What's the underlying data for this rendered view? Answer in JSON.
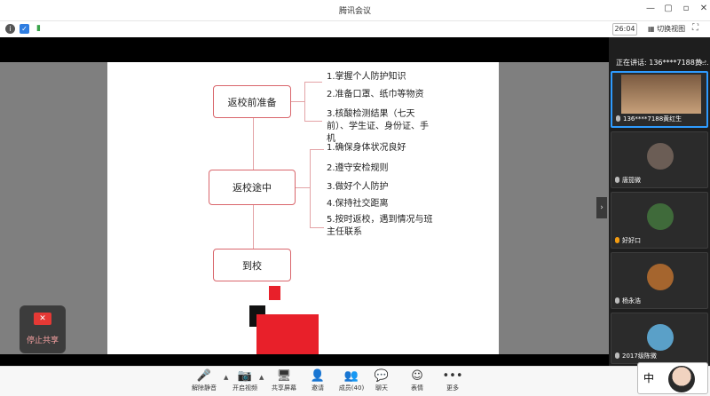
{
  "window": {
    "title": "腾讯会议",
    "controls": [
      "—",
      "▢",
      "▫",
      "✕"
    ]
  },
  "toolbar": {
    "timer": "26:04",
    "switch_view": "切换视图"
  },
  "slide": {
    "nodes": {
      "prep": "返校前准备",
      "transit": "返校途中",
      "arrive": "到校"
    },
    "prep_items": [
      "1.掌握个人防护知识",
      "2.准备口罩、纸巾等物资",
      "3.核酸检测结果（七天前）、学生证、身份证、手机"
    ],
    "transit_items": [
      "1.确保身体状况良好",
      "2.遵守安检规则",
      "3.做好个人防护",
      "4.保持社交距离",
      "5.按时返校，遇到情况与班主任联系"
    ]
  },
  "stop_share": {
    "label": "停止共享"
  },
  "panel": {
    "speaking": "正在讲话: 136****7188黄...",
    "participants": [
      {
        "name": "136****7188黄红生",
        "color": "#8a6a4a",
        "active": true
      },
      {
        "name": "唐笳微",
        "color": "#6b5d55"
      },
      {
        "name": "好好口",
        "color": "#3f6a3a"
      },
      {
        "name": "杨永浩",
        "color": "#a5652e"
      },
      {
        "name": "2017级陈微",
        "color": "#5aa0c8"
      }
    ]
  },
  "bottom": {
    "buttons": [
      {
        "label": "解除静音",
        "glyph": "🎤"
      },
      {
        "label": "开启视频",
        "glyph": "📷"
      },
      {
        "label": "共享屏幕",
        "glyph": "🖥"
      },
      {
        "label": "邀请",
        "glyph": "👤"
      },
      {
        "label": "成员(40)",
        "glyph": "👥"
      },
      {
        "label": "聊天",
        "glyph": "💬"
      },
      {
        "label": "表情",
        "glyph": "☺"
      },
      {
        "label": "更多",
        "glyph": "•••"
      }
    ]
  },
  "ime": {
    "char": "中"
  },
  "colors": {
    "accent": "#2e9bff",
    "node_border": "#d9666c",
    "red": "#e8202a"
  }
}
